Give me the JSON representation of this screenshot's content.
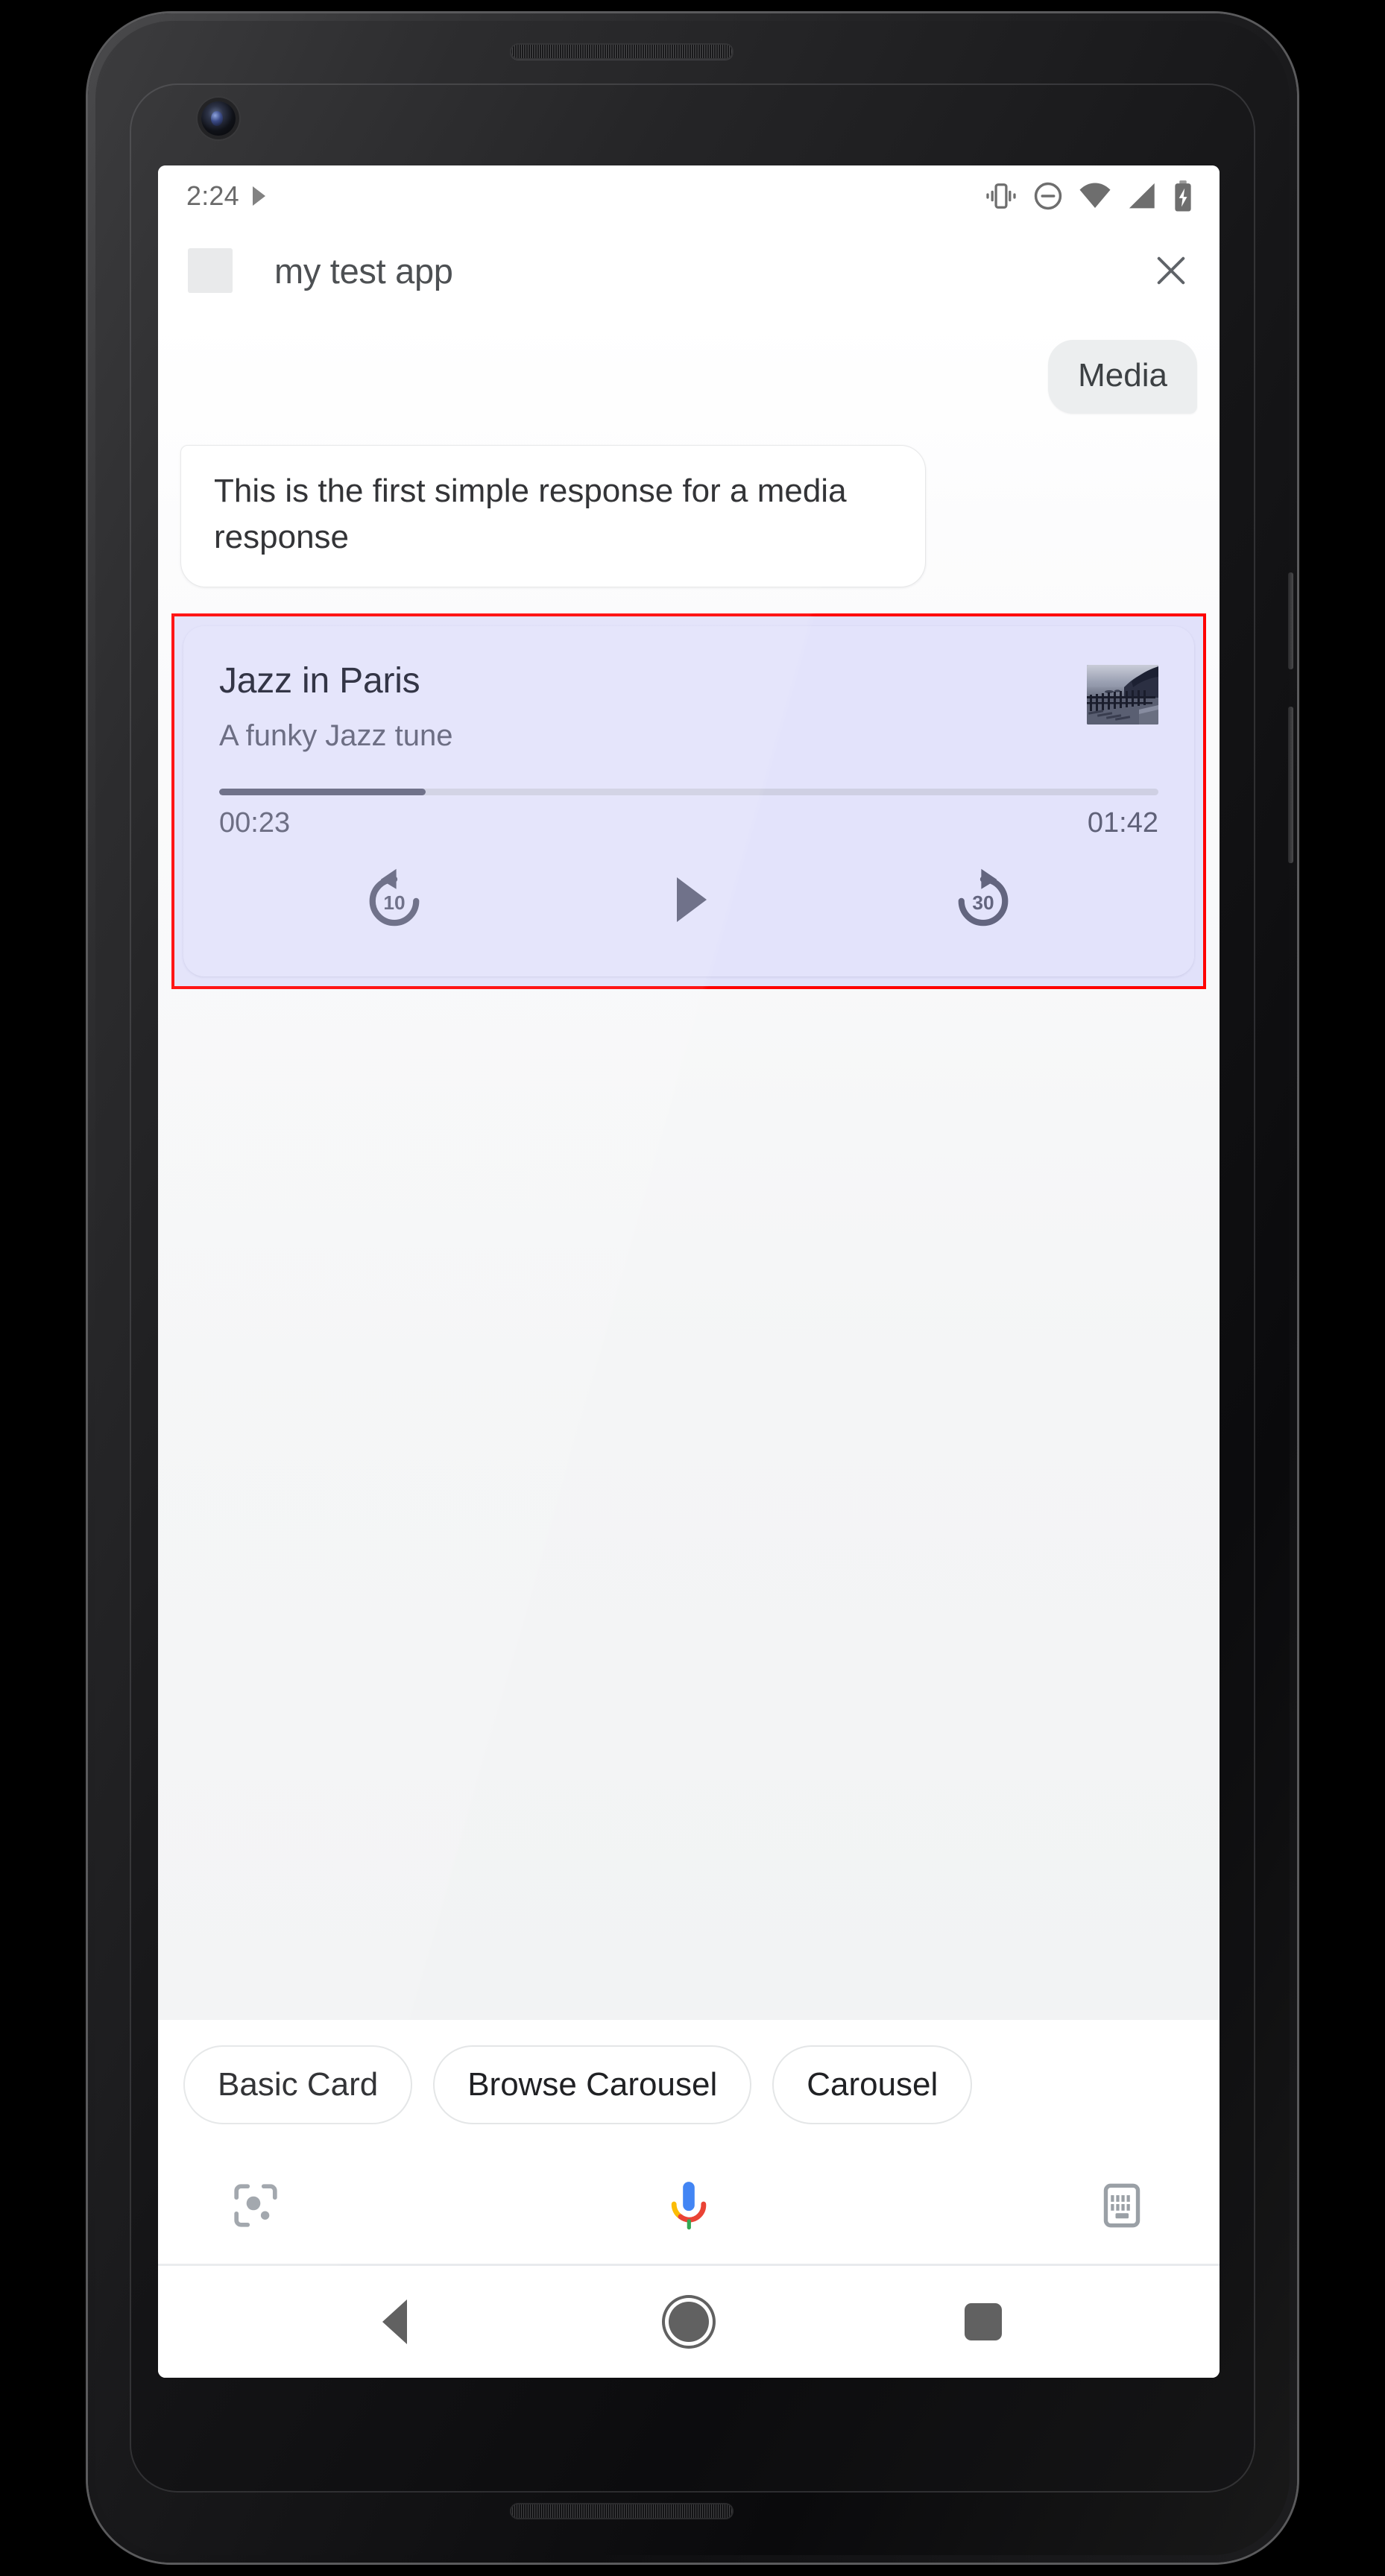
{
  "status_bar": {
    "time": "2:24",
    "icons": [
      "play-arrow-icon",
      "vibrate-icon",
      "do-not-disturb-icon",
      "wifi-icon",
      "cell-signal-icon",
      "battery-charging-icon"
    ]
  },
  "toolbar": {
    "app_icon": "app-icon-placeholder",
    "title": "my test app",
    "close_label": "close-icon"
  },
  "conversation": {
    "user_message": "Media",
    "agent_message": "This is the first simple response for a media response"
  },
  "media_card": {
    "highlighted": true,
    "highlight_color": "#ff0000",
    "card_background": "#e3e3fb",
    "title": "Jazz in Paris",
    "subtitle": "A funky Jazz tune",
    "album_art": "lake-fence-photo",
    "elapsed_time": "00:23",
    "total_time": "01:42",
    "progress_percent": 22,
    "controls": [
      {
        "name": "replay-10-icon",
        "label": "10"
      },
      {
        "name": "play-icon",
        "label": ""
      },
      {
        "name": "forward-30-icon",
        "label": "30"
      }
    ]
  },
  "suggestion_chips": [
    {
      "label": "Basic Card"
    },
    {
      "label": "Browse Carousel"
    },
    {
      "label": "Carousel"
    }
  ],
  "input_bar": {
    "lens_icon": "google-lens-icon",
    "mic_icon": "assistant-mic-icon",
    "keyboard_icon": "keyboard-icon"
  },
  "nav_bar": {
    "back": "back-triangle-icon",
    "home": "home-circle-icon",
    "recents": "recents-square-icon"
  },
  "colors": {
    "accent_lavender": "#e3e3fb",
    "progress_fill": "#63657f",
    "highlight_red": "#ff0000",
    "text_primary": "#202124",
    "text_secondary": "#5f6178",
    "chip_border": "#e4e6e7",
    "mic_blue": "#4285f4",
    "mic_red": "#ea4335",
    "mic_yellow": "#fbbc05",
    "mic_green": "#34a853"
  }
}
